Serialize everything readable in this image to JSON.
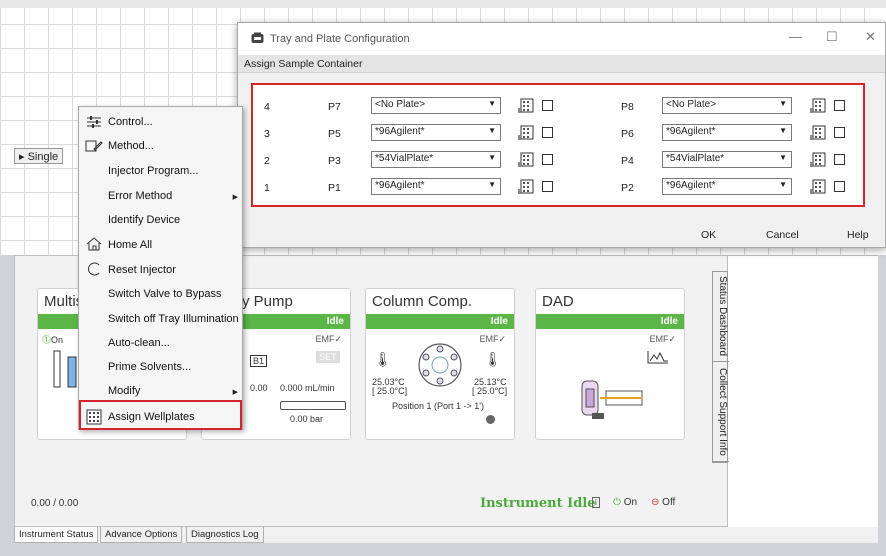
{
  "background": {
    "single_tab": "Single"
  },
  "dialog": {
    "title": "Tray and Plate Configuration",
    "subtitle": "Assign Sample Container",
    "rows": [
      {
        "num": "4",
        "left_pos": "P7",
        "left_plate": "<No Plate>",
        "right_pos": "P8",
        "right_plate": "<No Plate>"
      },
      {
        "num": "3",
        "left_pos": "P5",
        "left_plate": "*96Agilent*",
        "right_pos": "P6",
        "right_plate": "*96Agilent*"
      },
      {
        "num": "2",
        "left_pos": "P3",
        "left_plate": "*54VialPlate*",
        "right_pos": "P4",
        "right_plate": "*54VialPlate*"
      },
      {
        "num": "1",
        "left_pos": "P1",
        "left_plate": "*96Agilent*",
        "right_pos": "P2",
        "right_plate": "*96Agilent*"
      }
    ],
    "ok_label": "OK",
    "cancel_label": "Cancel",
    "help_label": "Help",
    "minimize": "—",
    "maximize": "☐",
    "close": "✕"
  },
  "context_menu": {
    "items": [
      {
        "label": "Control...",
        "icon": "sliders-icon",
        "submenu": false
      },
      {
        "label": "Method...",
        "icon": "method-icon",
        "submenu": false
      },
      {
        "label": "Injector Program...",
        "icon": "",
        "submenu": false
      },
      {
        "label": "Error Method",
        "icon": "",
        "submenu": true
      },
      {
        "label": "Identify Device",
        "icon": "",
        "submenu": false
      },
      {
        "label": "Home All",
        "icon": "home-icon",
        "submenu": false
      },
      {
        "label": "Reset Injector",
        "icon": "reset-icon",
        "submenu": false
      },
      {
        "label": "Switch Valve to Bypass",
        "icon": "",
        "submenu": false
      },
      {
        "label": "Switch off Tray Illumination",
        "icon": "",
        "submenu": false
      },
      {
        "label": "Auto-clean...",
        "icon": "",
        "submenu": false
      },
      {
        "label": "Prime Solvents...",
        "icon": "",
        "submenu": false
      },
      {
        "label": "Modify",
        "icon": "",
        "submenu": true
      },
      {
        "label": "Assign Wellplates",
        "icon": "wellplate-icon",
        "submenu": false
      }
    ]
  },
  "status": {
    "modules": {
      "multisampler": {
        "title": "Multis",
        "on_label": "On"
      },
      "pump": {
        "title": "y Pump",
        "state": "Idle",
        "emf": "EMF",
        "bottle": "B1",
        "set_label": "SET",
        "flow_left": "0.00",
        "flow": "0.000 mL/min",
        "pressure": "0.00 bar"
      },
      "column": {
        "title": "Column Comp.",
        "state": "Idle",
        "emf": "EMF",
        "temp_left": "25.03°C",
        "temp_left_set": "[ 25.0°C]",
        "temp_right": "25.13°C",
        "temp_right_set": "[ 25.0°C]",
        "position": "Position 1 (Port 1 -> 1')"
      },
      "dad": {
        "title": "DAD",
        "state": "Idle",
        "emf": "EMF"
      }
    },
    "counter": "0.00 / 0.00",
    "instrument_state": "Instrument Idle",
    "on_label": "On",
    "off_label": "Off",
    "side_tabs": [
      "Status Dashboard",
      "Collect Support Info"
    ]
  },
  "bottom_tabs": [
    "Instrument Status",
    "Advance Options",
    "Diagnostics Log"
  ],
  "colors": {
    "accent_green": "#5bb547",
    "highlight_red": "#d3252b"
  }
}
